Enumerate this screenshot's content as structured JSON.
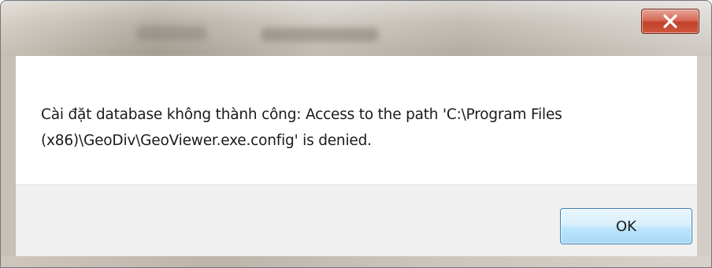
{
  "dialog": {
    "message": "Cài đặt database không thành công: Access to the path 'C:\\Program Files (x86)\\GeoDiv\\GeoViewer.exe.config' is denied.",
    "ok_label": "OK",
    "close_icon": "close-icon"
  },
  "colors": {
    "close_button": "#c7432d",
    "ok_button_border": "#3c7fb1",
    "footer_bg": "#f0f0f0"
  }
}
